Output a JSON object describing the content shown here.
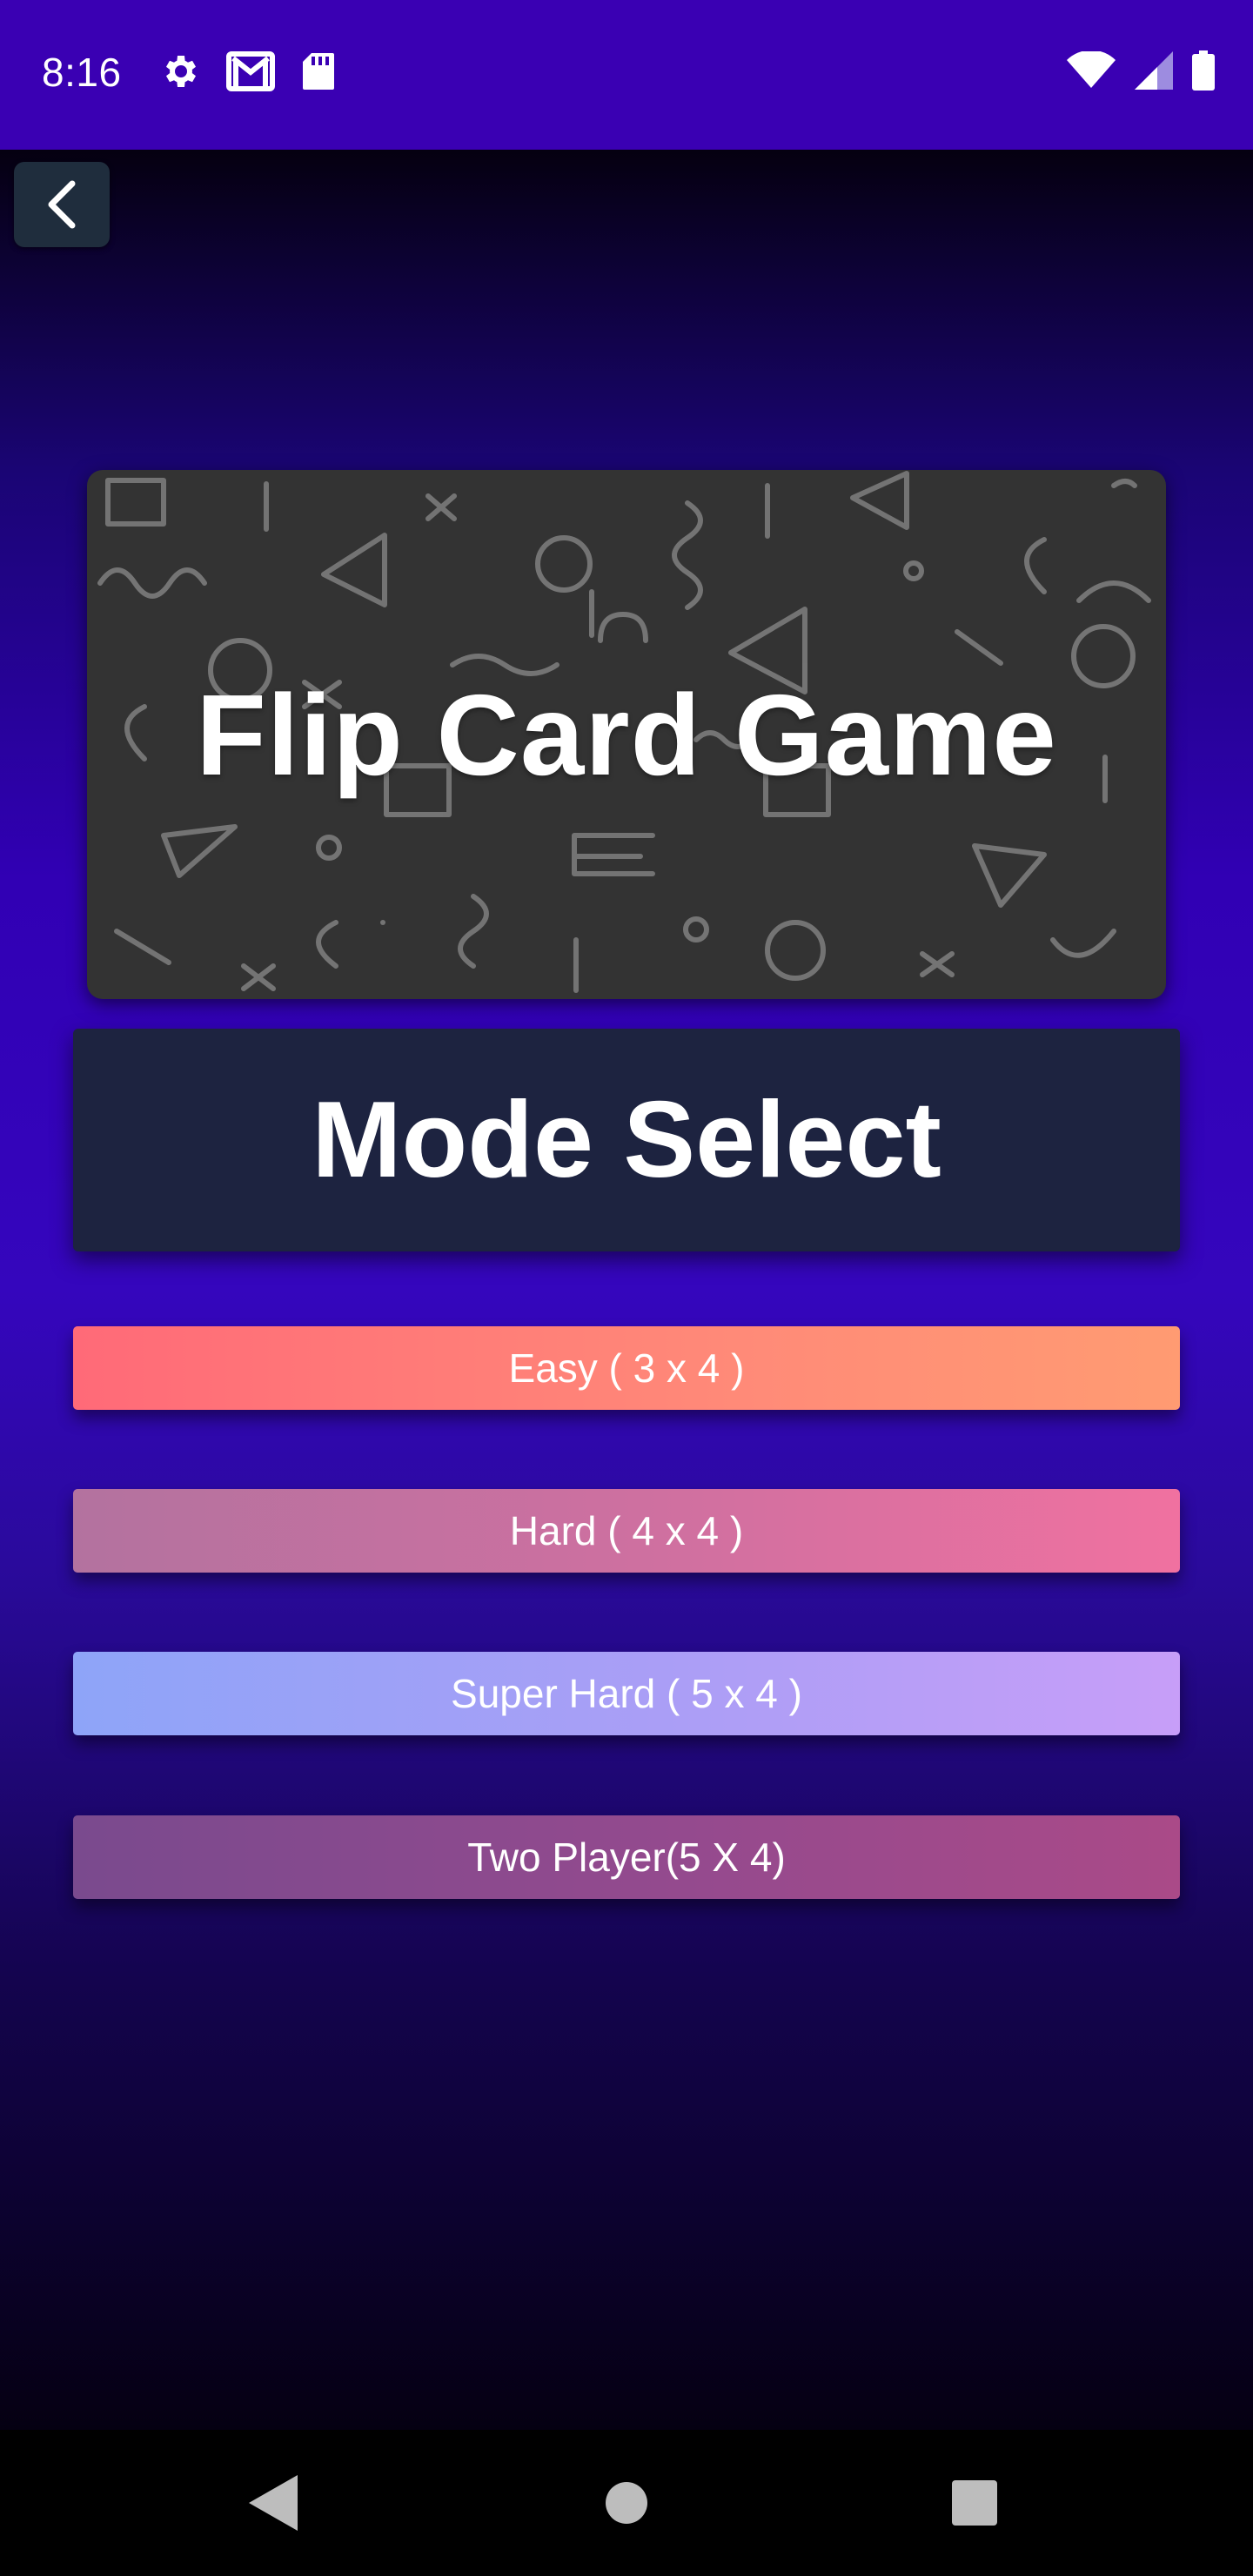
{
  "status_bar": {
    "time": "8:16",
    "background": "#3a00b3",
    "left_icons": [
      "settings-icon",
      "gmail-icon",
      "sd-card-icon"
    ],
    "right_icons": [
      "wifi-icon",
      "signal-icon",
      "battery-icon"
    ]
  },
  "header": {
    "back_icon": "chevron-left-icon"
  },
  "title_card": {
    "title": "Flip Card Game"
  },
  "mode_select": {
    "heading": "Mode Select"
  },
  "modes": [
    {
      "label": "Easy ( 3 x 4 )",
      "colors": [
        "#ff6a78",
        "#ff9b72"
      ]
    },
    {
      "label": "Hard ( 4 x 4 )",
      "colors": [
        "#b3729f",
        "#f071a0"
      ]
    },
    {
      "label": "Super Hard ( 5 x 4 )",
      "colors": [
        "#8ea4f8",
        "#c79ef8"
      ]
    },
    {
      "label": "Two Player(5 X 4)",
      "colors": [
        "#7a4a8e",
        "#aa4a88"
      ]
    }
  ],
  "nav_bar": {
    "icons": [
      "back-triangle-icon",
      "home-circle-icon",
      "recents-square-icon"
    ]
  }
}
